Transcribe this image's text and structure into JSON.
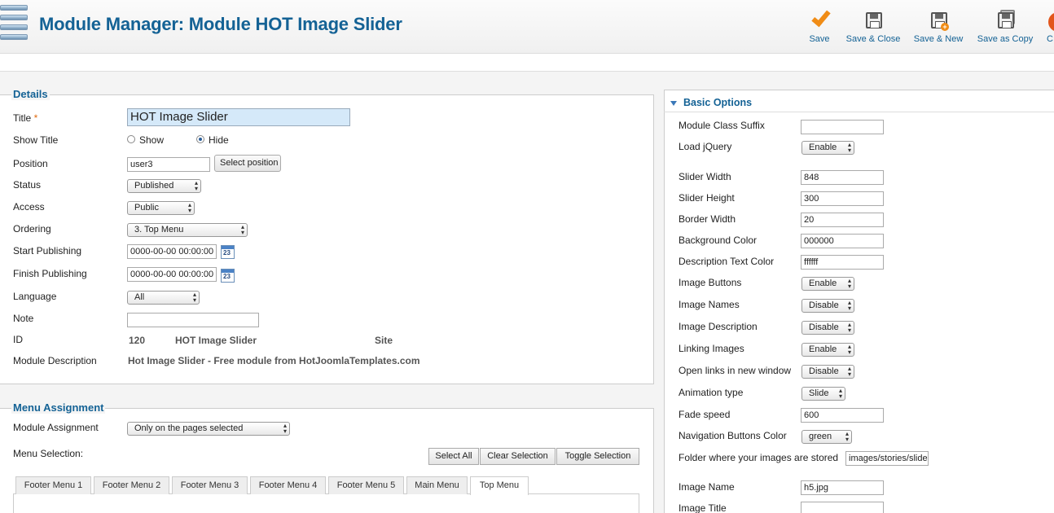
{
  "header": {
    "title": "Module Manager: Module HOT Image Slider",
    "toolbar": {
      "save": "Save",
      "save_close": "Save & Close",
      "save_new": "Save & New",
      "save_copy": "Save as Copy",
      "cut_label": "C"
    }
  },
  "details": {
    "legend": "Details",
    "title_label": "Title",
    "required_mark": "*",
    "title_value": "HOT Image Slider",
    "show_title_label": "Show Title",
    "show_label": "Show",
    "hide_label": "Hide",
    "position_label": "Position",
    "position_value": "user3",
    "select_position": "Select position",
    "status_label": "Status",
    "status_value": "Published",
    "access_label": "Access",
    "access_value": "Public",
    "ordering_label": "Ordering",
    "ordering_value": "3. Top Menu",
    "start_label": "Start Publishing",
    "start_value": "0000-00-00 00:00:00",
    "finish_label": "Finish Publishing",
    "finish_value": "0000-00-00 00:00:00",
    "calendar_day": "23",
    "language_label": "Language",
    "language_value": "All",
    "note_label": "Note",
    "note_value": "",
    "id_label": "ID",
    "id_value": "120",
    "id_name": "HOT Image Slider",
    "id_client": "Site",
    "desc_label": "Module Description",
    "desc_value": "Hot Image Slider - Free module from HotJoomlaTemplates.com"
  },
  "menu": {
    "legend": "Menu Assignment",
    "assignment_label": "Module Assignment",
    "assignment_value": "Only on the pages selected",
    "selection_label": "Menu Selection:",
    "select_all": "Select All",
    "clear_selection": "Clear Selection",
    "toggle_selection": "Toggle Selection",
    "tabs": [
      "Footer Menu 1",
      "Footer Menu 2",
      "Footer Menu 3",
      "Footer Menu 4",
      "Footer Menu 5",
      "Main Menu",
      "Top Menu"
    ]
  },
  "options": {
    "title": "Basic Options",
    "class_suffix_label": "Module Class Suffix",
    "class_suffix_value": "",
    "jquery_label": "Load jQuery",
    "jquery_value": "Enable",
    "width_label": "Slider Width",
    "width_value": "848",
    "height_label": "Slider Height",
    "height_value": "300",
    "border_label": "Border Width",
    "border_value": "20",
    "bg_label": "Background Color",
    "bg_value": "000000",
    "desc_color_label": "Description Text Color",
    "desc_color_value": "ffffff",
    "img_buttons_label": "Image Buttons",
    "img_buttons_value": "Enable",
    "img_names_label": "Image Names",
    "img_names_value": "Disable",
    "img_desc_label": "Image Description",
    "img_desc_value": "Disable",
    "linking_label": "Linking Images",
    "linking_value": "Enable",
    "newwin_label": "Open links in new window",
    "newwin_value": "Disable",
    "anim_label": "Animation type",
    "anim_value": "Slide",
    "fade_label": "Fade speed",
    "fade_value": "600",
    "navcolor_label": "Navigation Buttons Color",
    "navcolor_value": "green",
    "folder_label": "Folder where your images are stored",
    "folder_value": "images/stories/slides",
    "img_name_label": "Image Name",
    "img_name_value": "h5.jpg",
    "img_title_label": "Image Title",
    "img_title_value": ""
  }
}
